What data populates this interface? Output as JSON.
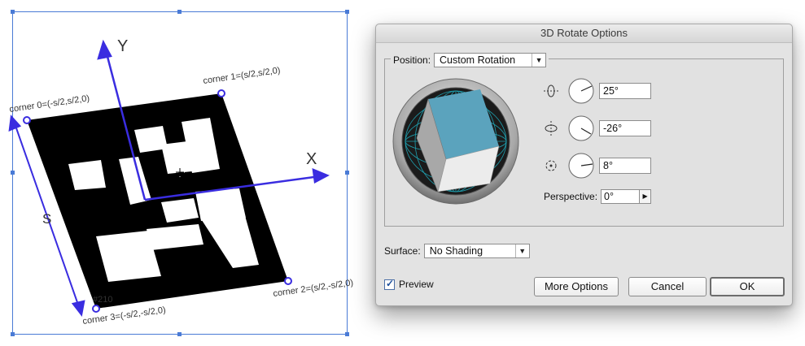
{
  "artboard": {
    "axis_x_label": "X",
    "axis_y_label": "Y",
    "side_label": "S",
    "marker_id": "#210",
    "corner_0": "corner 0=(-s/2,s/2,0)",
    "corner_1": "corner 1=(s/2,s/2,0)",
    "corner_2": "corner 2=(s/2,-s/2,0)",
    "corner_3": "corner 3=(-s/2,-s/2,0)",
    "colors": {
      "axes": "#3a2de0",
      "marker": "#000000",
      "selection": "#4a7bd6"
    }
  },
  "dialog": {
    "title": "3D Rotate Options",
    "position_label": "Position:",
    "position_value": "Custom Rotation",
    "rotations": [
      {
        "icon": "x-axis-rotate-icon",
        "value": "25°",
        "angle_deg": 25
      },
      {
        "icon": "y-axis-rotate-icon",
        "value": "-26°",
        "angle_deg": -26
      },
      {
        "icon": "z-axis-rotate-icon",
        "value": "8°",
        "angle_deg": 8
      }
    ],
    "perspective_label": "Perspective:",
    "perspective_value": "0°",
    "surface_label": "Surface:",
    "surface_value": "No Shading",
    "preview_label": "Preview",
    "preview_checked": true,
    "buttons": {
      "more_options": "More Options",
      "cancel": "Cancel",
      "ok": "OK"
    },
    "colors": {
      "cube_top": "#5ba3bd",
      "trackball_grid": "#1fb6c8"
    }
  }
}
